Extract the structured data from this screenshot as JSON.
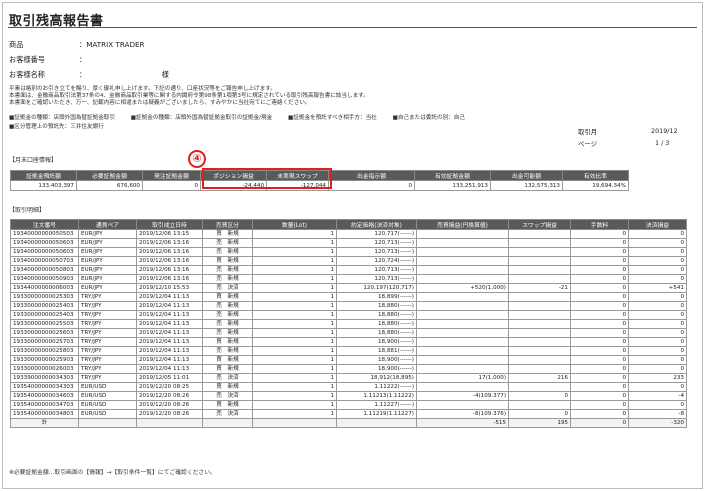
{
  "doc": {
    "title": "取引残高報告書"
  },
  "info": [
    {
      "label": "商品",
      "value": "：MATRIX TRADER"
    },
    {
      "label": "お客様番号",
      "value": "："
    },
    {
      "label": "お客様名称",
      "value": "：　　　　　　　　　　　様"
    }
  ],
  "notice": [
    "平素は格別のお引き立てを賜り、厚く御礼申し上げます。下記の通り、口座状況等をご報告申し上げます。",
    "本書面は、金融商品取引法第37条の4、金融商品取引業等に関する内閣府令第98条第1項第3号に規定されている取引残高報告書に該当します。",
    "本書面をご確認いただき、万一、記載内容に相違または疑義がございましたら、すみやかに当社宛てにご連絡ください。"
  ],
  "legend_line1": [
    "■証拠金の種類：店頭外国為替証拠金取引",
    "■証拠金の種類：店頭外国為替証拠金取引の証拠金/現金",
    "■証拠金を預託すべき相手方：当社",
    "■自己または委託の別：自己"
  ],
  "legend_line2": "■区分管理上の預託先：三井住友銀行",
  "meta": {
    "period_label": "取引月",
    "period_value": "2019/12",
    "page_label": "ページ",
    "page_value": "1 / 3"
  },
  "summary": {
    "section_label": "【月末口座情報】",
    "headers": [
      "証拠金預託額",
      "必要証拠金額",
      "発注証拠金額",
      "ポジション損益",
      "未実現スワップ",
      "出金指示額",
      "有効証拠金額",
      "出金可能額",
      "有効比率"
    ],
    "values": [
      "133,403,397",
      "676,600",
      "0",
      "-24,440",
      "-127,044",
      "0",
      "133,251,913",
      "132,575,313",
      "19,694.34%"
    ]
  },
  "badge": "④",
  "trades": {
    "section_label": "【取引明細】",
    "headers": [
      "注文番号",
      "通貨ペア",
      "取引成立日時",
      "売買区分",
      "数量(Lot)",
      "約定価格(決済対象)",
      "売買損益(円換算値)",
      "スワップ損益",
      "手数料",
      "決済損益"
    ],
    "rows": [
      [
        "19340000000050503",
        "EUR/JPY",
        "2019/12/06 13:15",
        "買　新規",
        "1",
        "120,717(------)",
        "",
        "",
        "0",
        "0"
      ],
      [
        "19340000000050603",
        "EUR/JPY",
        "2019/12/06 13:16",
        "売　新規",
        "1",
        "120,713(------)",
        "",
        "",
        "0",
        "0"
      ],
      [
        "19340000000050603",
        "EUR/JPY",
        "2019/12/06 13:16",
        "売　新規",
        "1",
        "120,713(------)",
        "",
        "",
        "0",
        "0"
      ],
      [
        "19340000000050703",
        "EUR/JPY",
        "2019/12/06 13:16",
        "買　新規",
        "1",
        "120,724(------)",
        "",
        "",
        "0",
        "0"
      ],
      [
        "19340000000050803",
        "EUR/JPY",
        "2019/12/06 13:16",
        "売　新規",
        "1",
        "120,713(------)",
        "",
        "",
        "0",
        "0"
      ],
      [
        "19340000000050903",
        "EUR/JPY",
        "2019/12/06 13:16",
        "売　新規",
        "1",
        "120,713(------)",
        "",
        "",
        "0",
        "0"
      ],
      [
        "19344000000006003",
        "EUR/JPY",
        "2019/12/10 15:53",
        "売　決済",
        "1",
        "120,197(120,717)",
        "+520(1,000)",
        "-21",
        "0",
        "+541"
      ],
      [
        "19330000000025303",
        "TRY/JPY",
        "2019/12/04 11:13",
        "買　新規",
        "1",
        "18,899(------)",
        "",
        "",
        "0",
        "0"
      ],
      [
        "19330000000025403",
        "TRY/JPY",
        "2019/12/04 11:13",
        "売　新規",
        "1",
        "18,880(------)",
        "",
        "",
        "0",
        "0"
      ],
      [
        "19330000000025403",
        "TRY/JPY",
        "2019/12/04 11:13",
        "売　新規",
        "1",
        "18,880(------)",
        "",
        "",
        "0",
        "0"
      ],
      [
        "19330000000025503",
        "TRY/JPY",
        "2019/12/04 11:13",
        "売　新規",
        "1",
        "18,880(------)",
        "",
        "",
        "0",
        "0"
      ],
      [
        "19330000000025603",
        "TRY/JPY",
        "2019/12/04 11:13",
        "売　新規",
        "1",
        "18,880(------)",
        "",
        "",
        "0",
        "0"
      ],
      [
        "19330000000025703",
        "TRY/JPY",
        "2019/12/04 11:13",
        "買　新規",
        "1",
        "18,900(------)",
        "",
        "",
        "0",
        "0"
      ],
      [
        "19330000000025803",
        "TRY/JPY",
        "2019/12/04 11:13",
        "売　新規",
        "1",
        "18,881(------)",
        "",
        "",
        "0",
        "0"
      ],
      [
        "19330000000025903",
        "TRY/JPY",
        "2019/12/04 11:13",
        "買　新規",
        "1",
        "18,900(------)",
        "",
        "",
        "0",
        "0"
      ],
      [
        "19330000000026003",
        "TRY/JPY",
        "2019/12/04 11:13",
        "買　新規",
        "1",
        "18,900(------)",
        "",
        "",
        "0",
        "0"
      ],
      [
        "19339000000034303",
        "TRY/JPY",
        "2019/12/05 11:01",
        "売　決済",
        "1",
        "18,912(18,895)",
        "17(1,000)",
        "216",
        "0",
        "233"
      ],
      [
        "19354000000034303",
        "EUR/USD",
        "2019/12/20 08:25",
        "買　新規",
        "1",
        "1.11222(------)",
        "",
        "",
        "0",
        "0"
      ],
      [
        "19354000000034603",
        "EUR/USD",
        "2019/12/20 08:26",
        "売　決済",
        "1",
        "1.11213(1.11222)",
        "-4(109.377)",
        "0",
        "0",
        "-4"
      ],
      [
        "19354000000034703",
        "EUR/USD",
        "2019/12/20 08:26",
        "買　新規",
        "1",
        "1.11227(------)",
        "",
        "",
        "0",
        "0"
      ],
      [
        "19354000000034803",
        "EUR/USD",
        "2019/12/20 08:26",
        "売　決済",
        "1",
        "1.11219(1.11227)",
        "-8(109.376)",
        "0",
        "0",
        "-8"
      ]
    ],
    "total": [
      "計",
      "",
      "",
      "",
      "",
      "",
      "-515",
      "195",
      "0",
      "-320"
    ]
  },
  "footnote": "※必要証拠金額…取引画面の【情報】→【取引条件一覧】にてご確認ください。"
}
